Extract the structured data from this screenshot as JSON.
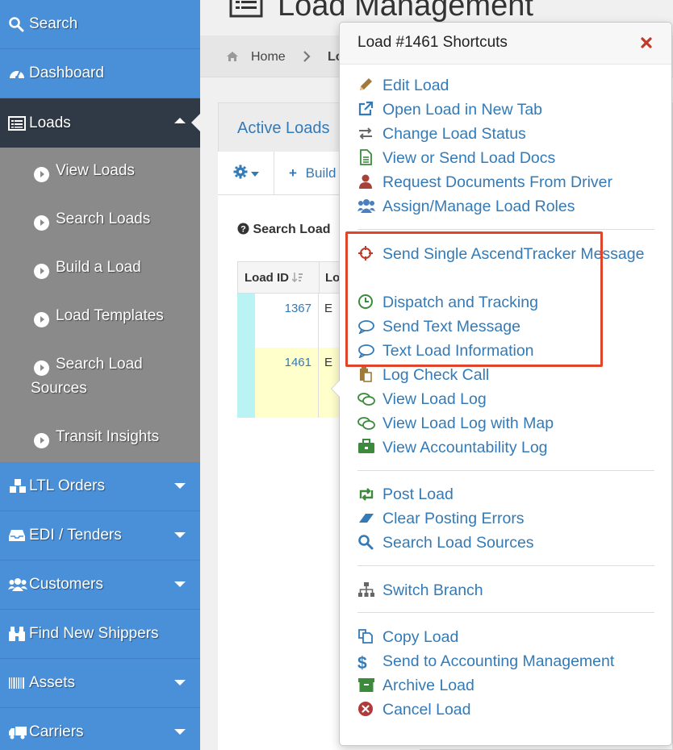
{
  "sidebar": {
    "items": [
      {
        "label": "Search",
        "icon": "search-icon"
      },
      {
        "label": "Dashboard",
        "icon": "dashboard-icon"
      },
      {
        "label": "Loads",
        "icon": "list-icon"
      },
      {
        "label": "LTL Orders",
        "icon": "cubes-icon"
      },
      {
        "label": "EDI / Tenders",
        "icon": "inbox-icon"
      },
      {
        "label": "Customers",
        "icon": "users-icon"
      },
      {
        "label": "Find New Shippers",
        "icon": "binoculars-icon"
      },
      {
        "label": "Assets",
        "icon": "barcode-icon"
      },
      {
        "label": "Carriers",
        "icon": "truck-icon"
      }
    ],
    "loads_submenu": [
      "View Loads",
      "Search Loads",
      "Build a Load",
      "Load Templates",
      "Search Load",
      "Sources",
      "Transit Insights"
    ]
  },
  "header": {
    "title": "Load Management",
    "breadcrumb": {
      "home": "Home",
      "current": "Lo"
    }
  },
  "tabs": {
    "active": "Active Loads"
  },
  "toolbar": {
    "build_label": "Build"
  },
  "search_section": {
    "label": "Search Load"
  },
  "grid": {
    "headers": [
      "Load ID",
      "Lo"
    ],
    "rows": [
      {
        "id": "1367",
        "col2": "E"
      },
      {
        "id": "1461",
        "col2": "E"
      }
    ]
  },
  "popover": {
    "title": "Load #1461 Shortcuts",
    "items": [
      "Edit Load",
      "Open Load in New Tab",
      "Change Load Status",
      "View or Send Load Docs",
      "Request Documents From Driver",
      "Assign/Manage Load Roles",
      "Send Single AscendTracker Message",
      "Dispatch and Tracking",
      "Send Text Message",
      "Text Load Information",
      "Log Check Call",
      "View Load Log",
      "View Load Log with Map",
      "View Accountability Log",
      "Post Load",
      "Clear Posting Errors",
      "Search Load Sources",
      "Switch Branch",
      "Copy Load",
      "Send to Accounting Management",
      "Archive Load",
      "Cancel Load"
    ]
  },
  "colors": {
    "sidebar_bg": "#4a90d9",
    "sidebar_active": "#2f3a46",
    "submenu_bg": "#8a8a8a",
    "link": "#337ab7",
    "highlight": "#e0442a",
    "close": "#c0392b"
  }
}
